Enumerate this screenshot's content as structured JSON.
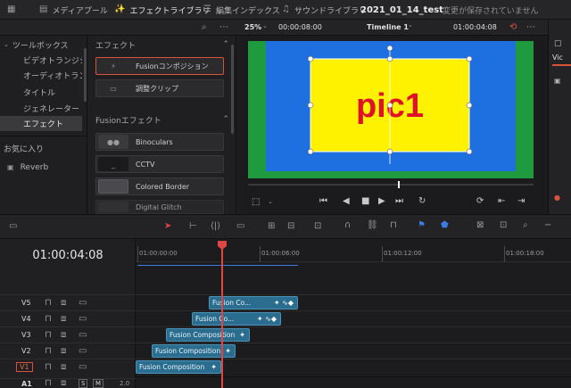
{
  "topbar": {
    "media_pool": "メディアプール",
    "effects_library": "エフェクトライブラリ",
    "edit_index": "編集インデックス",
    "sound_library": "サウンドライブラリ",
    "project_title": "2021_01_14_test",
    "save_status": "変更が保存されていません"
  },
  "viewer": {
    "zoom": "25%",
    "source_timecode": "00:00:08:00",
    "timeline_name": "Timeline 1",
    "record_timecode": "01:00:04:08",
    "canvas_text": "pic1"
  },
  "toolbox": {
    "header": "ツールボックス",
    "items": [
      "ビデオトランジション",
      "オーディオトランジ...",
      "タイトル",
      "ジェネレーター",
      "エフェクト"
    ],
    "favorites": "お気に入り",
    "reverb": "Reverb"
  },
  "effects": {
    "header": "エフェクト",
    "items": [
      "Fusionコンポジション",
      "調整クリップ"
    ],
    "fusion_header": "Fusionエフェクト",
    "fusion_items": [
      "Binoculars",
      "CCTV",
      "Colored Border",
      "Digital Glitch"
    ]
  },
  "inspector": {
    "tab": "Vic"
  },
  "timeline": {
    "timecode": "01:00:04:08",
    "ruler": [
      "01:00:00:00",
      "01:00:06:00",
      "01:00:12:00",
      "01:00:18:00"
    ],
    "tracks": [
      "V5",
      "V4",
      "V3",
      "V2",
      "V1",
      "A1"
    ],
    "audio_buttons": [
      "S",
      "M"
    ],
    "audio_level": "2.0",
    "clips": [
      "Fusion Co...",
      "Fusion Co...",
      "Fusion Composition",
      "Fusion Composition",
      "Fusion Composition"
    ]
  },
  "colors": {
    "accent": "#d9533a",
    "clip": "#2a6d8f",
    "canvas_green": "#1f9a3e",
    "canvas_blue": "#1e6fe0",
    "canvas_yellow": "#fff200",
    "canvas_text": "#e0102a"
  }
}
